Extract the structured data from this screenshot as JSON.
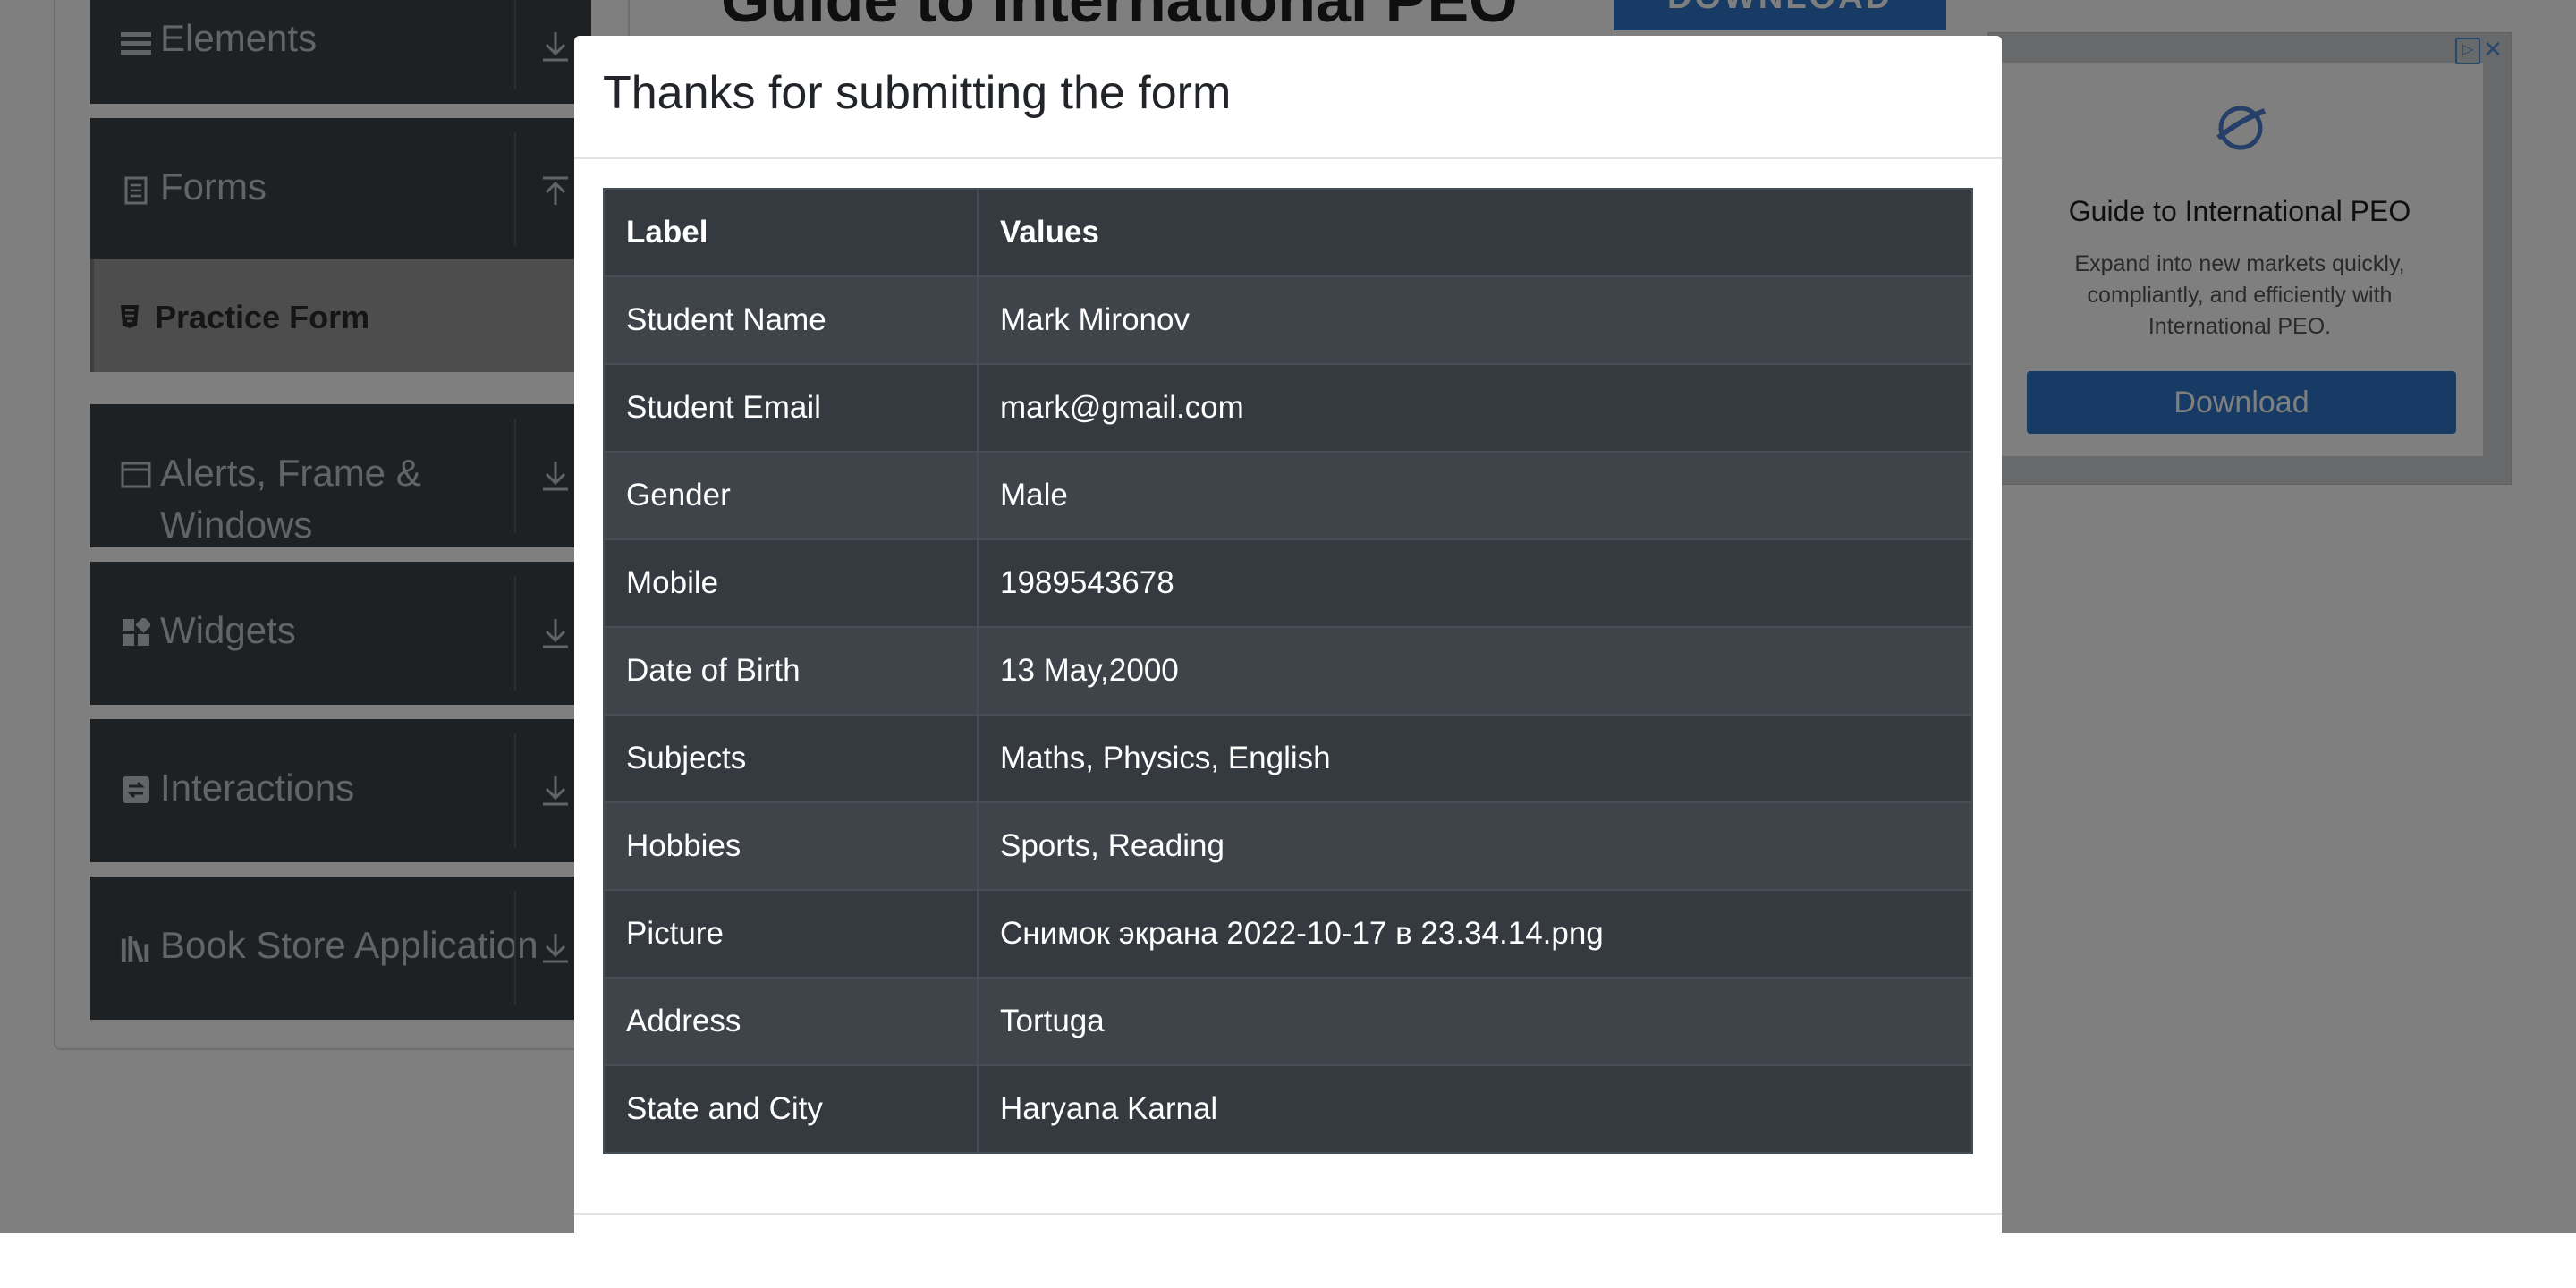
{
  "sidebar": {
    "groups": [
      {
        "label": "Elements",
        "icon": "hamburger-icon",
        "arrow": "download-arrow-icon"
      },
      {
        "label": "Forms",
        "icon": "document-icon",
        "arrow": "upload-arrow-icon"
      },
      {
        "label": "Alerts, Frame & Windows",
        "icon": "window-icon",
        "arrow": "download-arrow-icon"
      },
      {
        "label": "Widgets",
        "icon": "widgets-icon",
        "arrow": "download-arrow-icon"
      },
      {
        "label": "Interactions",
        "icon": "interactions-icon",
        "arrow": "download-arrow-icon"
      },
      {
        "label": "Book Store Application",
        "icon": "books-icon",
        "arrow": "download-arrow-icon"
      }
    ],
    "active_item": "Practice Form"
  },
  "ad_top": {
    "title": "Guide to International PEO",
    "button": "DOWNLOAD"
  },
  "ad_side": {
    "title": "Guide to International PEO",
    "description": "Expand into new markets quickly, compliantly, and efficiently with International PEO.",
    "button": "Download"
  },
  "modal": {
    "title": "Thanks for submitting the form",
    "table": {
      "headers": [
        "Label",
        "Values"
      ],
      "rows": [
        [
          "Student Name",
          "Mark Mironov"
        ],
        [
          "Student Email",
          "mark@gmail.com"
        ],
        [
          "Gender",
          "Male"
        ],
        [
          "Mobile",
          "1989543678"
        ],
        [
          "Date of Birth",
          "13 May,2000"
        ],
        [
          "Subjects",
          "Maths, Physics, English"
        ],
        [
          "Hobbies",
          "Sports, Reading"
        ],
        [
          "Picture",
          "Снимок экрана 2022-10-17 в 23.34.14.png"
        ],
        [
          "Address",
          "Tortuga"
        ],
        [
          "State and City",
          "Haryana Karnal"
        ]
      ]
    }
  },
  "colors": {
    "table_dark": "#343a40",
    "table_stripe": "#3e444a",
    "sidebar_group": "#3d4246",
    "ad_blue": "#2f77c9"
  }
}
